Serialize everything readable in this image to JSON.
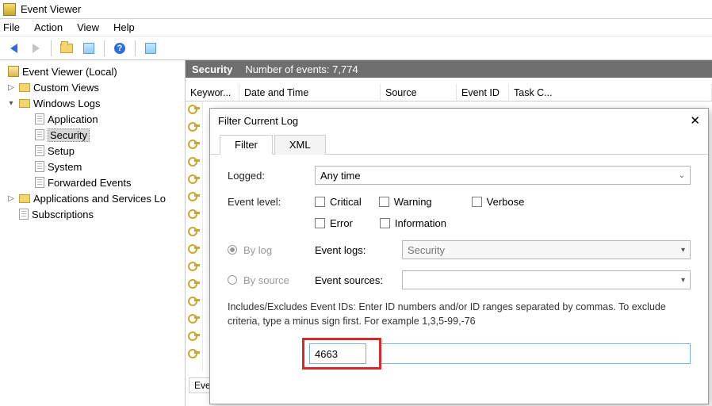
{
  "app": {
    "title": "Event Viewer"
  },
  "menu": {
    "file": "File",
    "action": "Action",
    "view": "View",
    "help": "Help"
  },
  "tree": {
    "root": "Event Viewer (Local)",
    "custom_views": "Custom Views",
    "windows_logs": "Windows Logs",
    "application": "Application",
    "security": "Security",
    "setup": "Setup",
    "system": "System",
    "forwarded": "Forwarded Events",
    "apps_services": "Applications and Services Lo",
    "subscriptions": "Subscriptions"
  },
  "header": {
    "section": "Security",
    "events_label": "Number of events:",
    "events_count": "7,774"
  },
  "columns": {
    "keywords": "Keywor...",
    "datetime": "Date and Time",
    "source": "Source",
    "event_id": "Event ID",
    "task": "Task C..."
  },
  "dialog": {
    "title": "Filter Current Log",
    "tabs": {
      "filter": "Filter",
      "xml": "XML"
    },
    "logged": "Logged:",
    "logged_value": "Any time",
    "event_level": "Event level:",
    "levels": {
      "critical": "Critical",
      "warning": "Warning",
      "verbose": "Verbose",
      "error": "Error",
      "information": "Information"
    },
    "by_log": "By log",
    "by_source": "By source",
    "event_logs": "Event logs:",
    "event_logs_value": "Security",
    "event_sources": "Event sources:",
    "hint": "Includes/Excludes Event IDs: Enter ID numbers and/or ID ranges separated by commas. To exclude criteria, type a minus sign first. For example 1,3,5-99,-76",
    "id_value": "4663"
  },
  "stub": {
    "event_short": "Ever"
  }
}
